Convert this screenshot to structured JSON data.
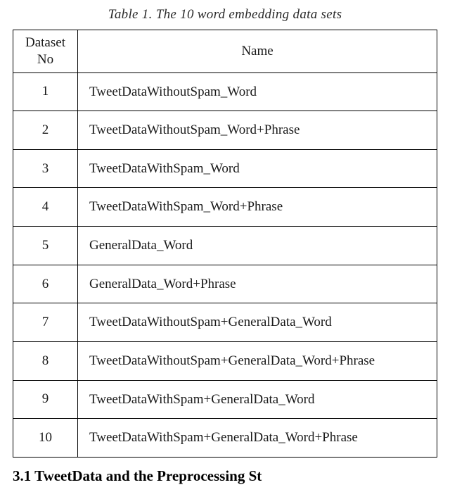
{
  "caption": "Table 1. The 10 word embedding data sets",
  "headers": {
    "no": "Dataset No",
    "name": "Name"
  },
  "rows": [
    {
      "no": "1",
      "name": "TweetDataWithoutSpam_Word"
    },
    {
      "no": "2",
      "name": "TweetDataWithoutSpam_Word+Phrase"
    },
    {
      "no": "3",
      "name": "TweetDataWithSpam_Word"
    },
    {
      "no": "4",
      "name": "TweetDataWithSpam_Word+Phrase"
    },
    {
      "no": "5",
      "name": "GeneralData_Word"
    },
    {
      "no": "6",
      "name": "GeneralData_Word+Phrase"
    },
    {
      "no": "7",
      "name": "TweetDataWithoutSpam+GeneralData_Word"
    },
    {
      "no": "8",
      "name": "TweetDataWithoutSpam+GeneralData_Word+Phrase"
    },
    {
      "no": "9",
      "name": "TweetDataWithSpam+GeneralData_Word"
    },
    {
      "no": "10",
      "name": "TweetDataWithSpam+GeneralData_Word+Phrase"
    }
  ],
  "footer_partial": "3.1    TweetData and the Preprocessing St"
}
